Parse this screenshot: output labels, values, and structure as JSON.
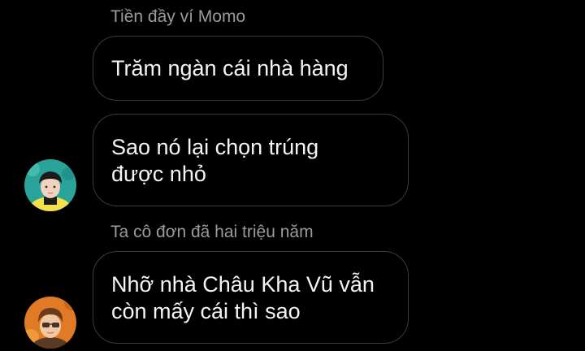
{
  "chat": {
    "messages": [
      {
        "sender": "Tiền đầy ví Momo",
        "text": "Trăm ngàn cái nhà hàng"
      },
      {
        "text": "Sao nó lại chọn trúng\nđược nhỏ",
        "avatar": "avatar-teal-bg-boy-icon"
      },
      {
        "sender": "Ta cô đơn đã hai triệu năm",
        "text": "Nhỡ nhà Châu Kha Vũ vẫn\ncòn mấy cái thì sao",
        "avatar": "avatar-orange-bg-boy-icon"
      }
    ]
  },
  "colors": {
    "background": "#000000",
    "bubble_border": "#3b3b3b",
    "sender_name": "#9a9a9a",
    "message_text": "#f4f4f4"
  }
}
